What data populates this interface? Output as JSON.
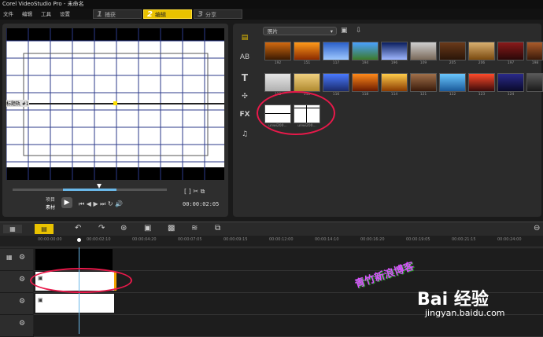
{
  "window": {
    "title": "Corel VideoStudio Pro - 未命名"
  },
  "menu": [
    "文件",
    "编辑",
    "工具",
    "设置"
  ],
  "steps": [
    {
      "num": "1",
      "label": "捕获"
    },
    {
      "num": "2",
      "label": "编辑"
    },
    {
      "num": "3",
      "label": "分享"
    }
  ],
  "preview": {
    "overlay_label": "标题轨 #1",
    "mode_project": "项目",
    "mode_clip": "素材",
    "timecode": "00:00:02:05"
  },
  "library": {
    "dropdown": "照片",
    "row1_labels": [
      "192",
      "151",
      "117",
      "194",
      "196",
      "109",
      "205",
      "206",
      "197",
      "198",
      "199"
    ],
    "row2_labels": [
      "113",
      "111",
      "116",
      "118",
      "114",
      "121",
      "122",
      "123",
      "124"
    ],
    "row3_labels": [
      "unwi200...",
      "unwi200..."
    ]
  },
  "ruler": [
    "00:00:00:00",
    "00:00:02:10",
    "00:00:04:20",
    "00:00:07:05",
    "00:00:09:15",
    "00:00:12:00",
    "00:00:14:10",
    "00:00:16:20",
    "00:00:19:05",
    "00:00:21:15",
    "00:00:24:00"
  ],
  "watermark": {
    "blog": "青竹新浪博客",
    "brand": "Bai 经验",
    "url": "jingyan.baidu.com"
  },
  "colors": {
    "active_step": "#e9c200",
    "highlight": "#e8194a",
    "timeline_clip": "#ffffff",
    "clip_edge": "#f2a400"
  }
}
